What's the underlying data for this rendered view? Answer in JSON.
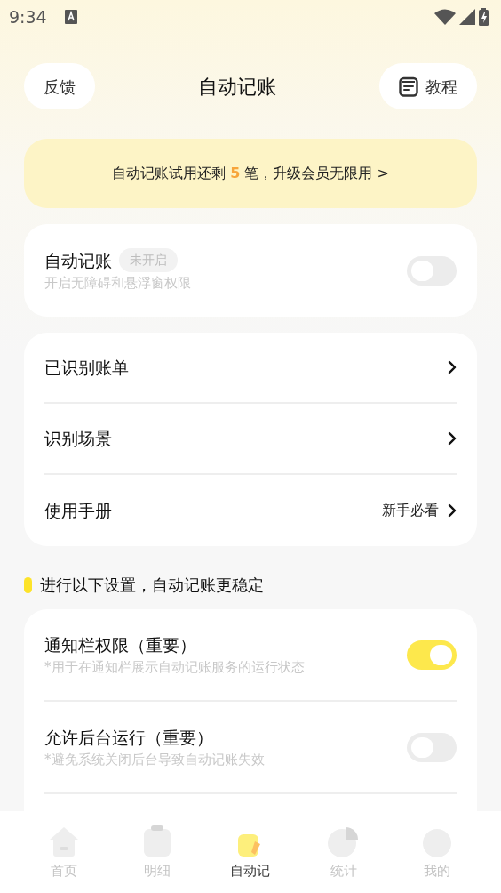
{
  "status_bar": {
    "time": "9:34"
  },
  "header": {
    "left_button": "反馈",
    "title": "自动记账",
    "right_button": "教程"
  },
  "banner": {
    "text": "自动记账试用还剩 **5** 笔，升级会员无限用 >"
  },
  "main_switch": {
    "title": "自动记账",
    "tag": "未开启",
    "subtitle": "开启无障碍和悬浮窗权限",
    "on": false
  },
  "menu": [
    {
      "label": "已识别账单"
    },
    {
      "label": "识别场景"
    },
    {
      "label": "使用手册",
      "hint": "新手必看"
    }
  ],
  "section_title": "进行以下设置，自动记账更稳定",
  "settings": [
    {
      "title": "通知栏权限（重要）",
      "subtitle": "*用于在通知栏展示自动记账服务的运行状态",
      "on": true
    },
    {
      "title": "允许后台运行（重要）",
      "subtitle": "*避免系统关闭后台导致自动记账失效",
      "on": false
    }
  ],
  "tabs": [
    {
      "label": "首页",
      "kind": "home",
      "selected": false
    },
    {
      "label": "明细",
      "kind": "detail",
      "selected": false
    },
    {
      "label": "自动记",
      "kind": "auto",
      "selected": true
    },
    {
      "label": "统计",
      "kind": "stats",
      "selected": false
    },
    {
      "label": "我的",
      "kind": "mine",
      "selected": false
    }
  ]
}
